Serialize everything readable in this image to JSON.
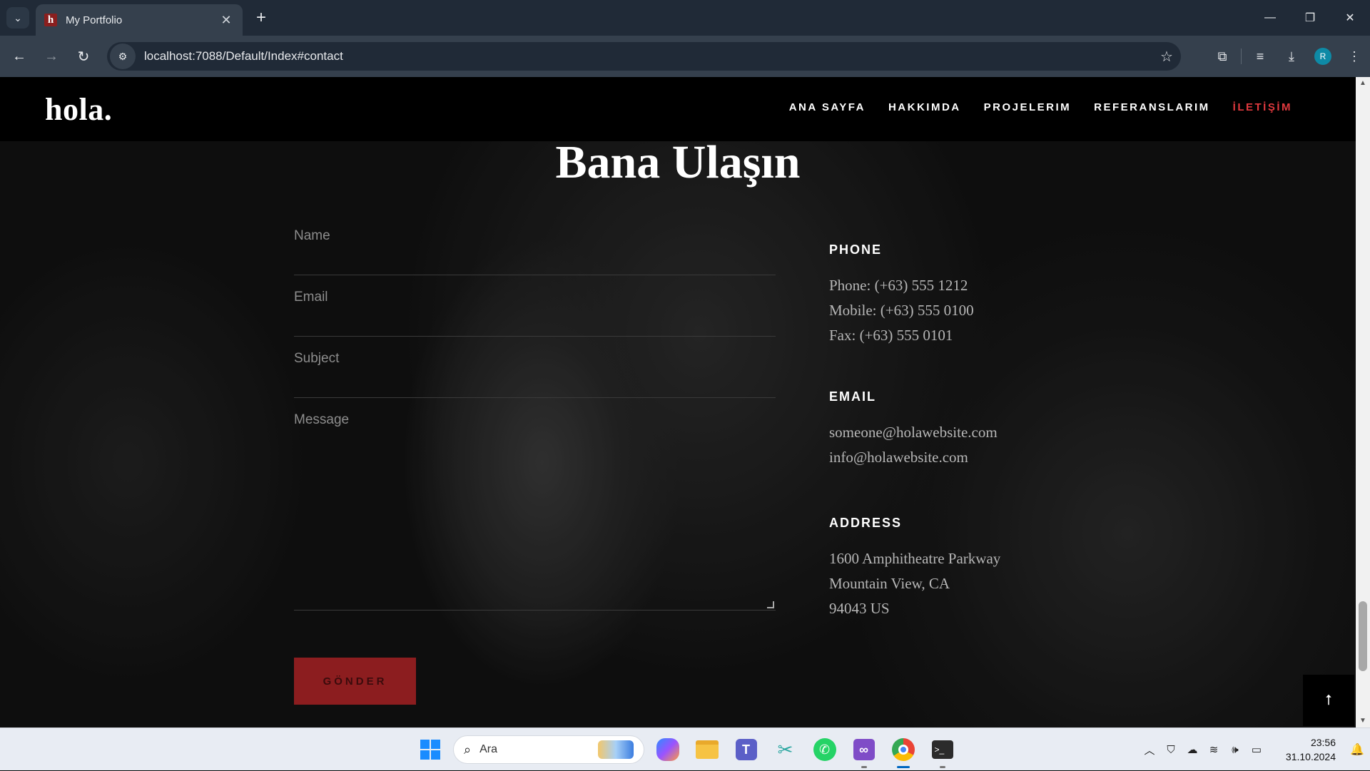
{
  "browser": {
    "tab_title": "My Portfolio",
    "tab_favicon_letter": "h",
    "url": "localhost:7088/Default/Index#contact",
    "profile_initial": "R"
  },
  "site": {
    "logo": "hola.",
    "nav": [
      {
        "label": "ANA SAYFA",
        "active": false
      },
      {
        "label": "HAKKIMDA",
        "active": false
      },
      {
        "label": "PROJELERIM",
        "active": false
      },
      {
        "label": "REFERANSLARIM",
        "active": false
      },
      {
        "label": "İLETİŞİM",
        "active": true
      }
    ],
    "accent_color": "#e0393e",
    "button_color": "#8c1d1f"
  },
  "contact": {
    "title": "Bana Ulaşın",
    "form": {
      "name_placeholder": "Name",
      "email_placeholder": "Email",
      "subject_placeholder": "Subject",
      "message_placeholder": "Message",
      "submit_label": "GÖNDER"
    },
    "phone": {
      "heading": "PHONE",
      "lines": [
        "Phone: (+63) 555 1212",
        "Mobile: (+63) 555 0100",
        "Fax: (+63) 555 0101"
      ]
    },
    "email": {
      "heading": "EMAIL",
      "lines": [
        "someone@holawebsite.com",
        "info@holawebsite.com"
      ]
    },
    "address": {
      "heading": "ADDRESS",
      "lines": [
        "1600 Amphitheatre Parkway",
        "Mountain View, CA",
        "94043 US"
      ]
    },
    "back_to_top_icon": "arrow-up-icon"
  },
  "taskbar": {
    "search_placeholder": "Ara",
    "time": "23:56",
    "date": "31.10.2024"
  }
}
